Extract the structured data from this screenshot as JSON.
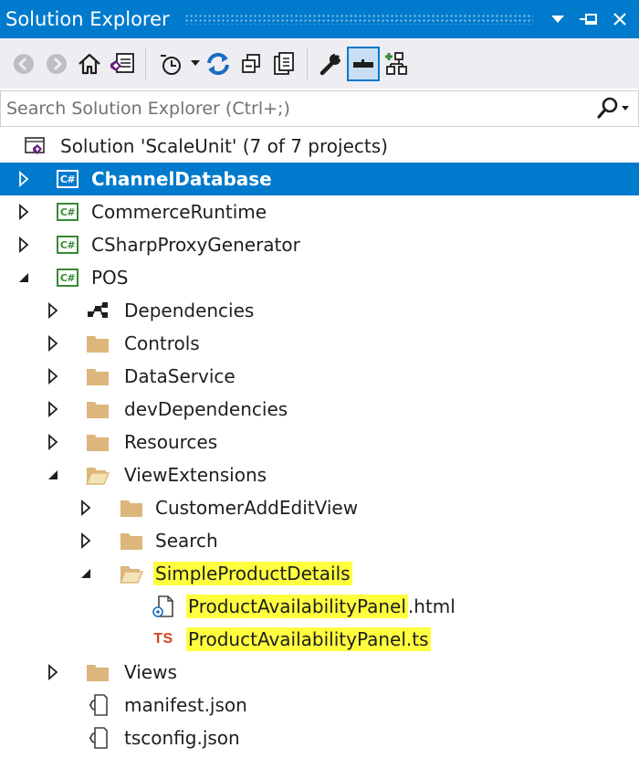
{
  "window": {
    "title": "Solution Explorer",
    "buttons": [
      {
        "name": "dropdown-icon"
      },
      {
        "name": "pin-icon"
      },
      {
        "name": "close-icon"
      }
    ]
  },
  "toolbar": {
    "buttons": [
      {
        "name": "back-icon",
        "enabled": false
      },
      {
        "name": "forward-icon",
        "enabled": false
      },
      {
        "name": "home-icon"
      },
      {
        "name": "switch-views-icon"
      },
      {
        "name": "pending-changes-filter-icon",
        "has_dropdown": true
      },
      {
        "name": "sync-with-active-document-icon"
      },
      {
        "name": "collapse-all-icon"
      },
      {
        "name": "show-all-files-icon"
      },
      {
        "name": "properties-wrench-icon"
      },
      {
        "name": "preview-selected-items-icon",
        "pressed": true
      },
      {
        "name": "class-diagram-icon"
      }
    ]
  },
  "search": {
    "placeholder": "Search Solution Explorer (Ctrl+;)",
    "value": ""
  },
  "tree": {
    "solution": {
      "label": "Solution 'ScaleUnit' (7 of 7 projects)",
      "icon": "solution-icon"
    },
    "projects": [
      {
        "label": "ChannelDatabase",
        "icon": "csharp-project-icon",
        "expanded": false,
        "selected": true
      },
      {
        "label": "CommerceRuntime",
        "icon": "csharp-project-icon",
        "expanded": false
      },
      {
        "label": "CSharpProxyGenerator",
        "icon": "csharp-project-icon",
        "expanded": false
      },
      {
        "label": "POS",
        "icon": "csharp-project-icon",
        "expanded": true
      }
    ],
    "pos_children": {
      "dependencies": {
        "label": "Dependencies",
        "icon": "dependencies-icon"
      },
      "controls": {
        "label": "Controls",
        "icon": "folder-icon"
      },
      "dataservice": {
        "label": "DataService",
        "icon": "folder-icon"
      },
      "devdependencies": {
        "label": "devDependencies",
        "icon": "folder-icon"
      },
      "resources": {
        "label": "Resources",
        "icon": "folder-icon"
      },
      "viewextensions": {
        "label": "ViewExtensions",
        "icon": "folder-open-icon",
        "expanded": true
      },
      "customeraddeditview": {
        "label": "CustomerAddEditView",
        "icon": "folder-icon"
      },
      "search": {
        "label": "Search",
        "icon": "folder-icon"
      },
      "simpleproductdetails": {
        "label": "SimpleProductDetails",
        "icon": "folder-open-icon",
        "expanded": true,
        "highlighted": true
      },
      "html_file": {
        "label_main": "ProductAvailabilityPanel",
        "label_ext": ".html",
        "icon": "html-file-icon",
        "highlighted": true
      },
      "ts_file": {
        "label_main": "ProductAvailabilityPanel",
        "label_ext": ".ts",
        "icon": "typescript-file-icon",
        "icon_text": "TS",
        "highlighted": true
      },
      "views": {
        "label": "Views",
        "icon": "folder-icon"
      },
      "manifest": {
        "label": "manifest.json",
        "icon": "json-file-icon"
      },
      "tsconfig": {
        "label": "tsconfig.json",
        "icon": "json-file-icon"
      }
    },
    "csharp_icon_text": "C#"
  },
  "colors": {
    "accent": "#007acc",
    "selection_text": "#ffffff",
    "toolbar_bg": "#eeeef2",
    "folder": "#dcb67a",
    "csharp_green": "#388a34",
    "typescript": "#d1451f",
    "highlight": "#ffff3f"
  }
}
